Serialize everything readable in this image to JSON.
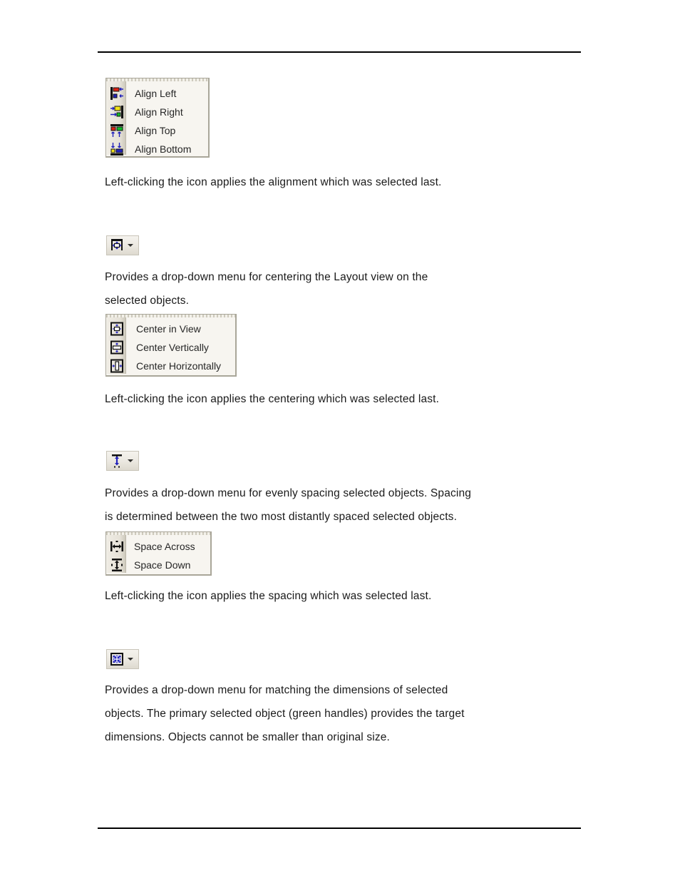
{
  "document": {
    "header_rule": true,
    "footer_rule": true
  },
  "align": {
    "menu_name": "align-dropdown-menu",
    "items": [
      {
        "label": "Align Left",
        "icon": "align-left-icon"
      },
      {
        "label": "Align Right",
        "icon": "align-right-icon"
      },
      {
        "label": "Align Top",
        "icon": "align-top-icon"
      },
      {
        "label": "Align Bottom",
        "icon": "align-bottom-icon"
      }
    ],
    "caption": "Left-clicking the icon applies the alignment which was selected last."
  },
  "center": {
    "button_icon": "center-in-view-toolbar-icon",
    "description": "Provides a drop-down menu for centering the Layout view on the\nselected objects.",
    "items": [
      {
        "label": "Center in View",
        "icon": "center-in-view-icon"
      },
      {
        "label": "Center Vertically",
        "icon": "center-vertically-icon"
      },
      {
        "label": "Center Horizontally",
        "icon": "center-horizontally-icon"
      }
    ],
    "caption": "Left-clicking the icon applies the centering which was selected last."
  },
  "space": {
    "button_icon": "space-down-toolbar-icon",
    "description": "Provides a drop-down menu for evenly spacing selected objects. Spacing\nis determined between the two most distantly spaced selected objects.",
    "items": [
      {
        "label": "Space Across",
        "icon": "space-across-icon"
      },
      {
        "label": "Space Down",
        "icon": "space-down-icon"
      }
    ],
    "caption": "Left-clicking the icon applies the spacing which was selected last."
  },
  "match": {
    "button_icon": "match-dimensions-toolbar-icon",
    "description": "Provides a drop-down menu for matching the dimensions of selected\nobjects. The primary selected object (green handles) provides the target\ndimensions. Objects cannot be smaller than original size."
  },
  "colors": {
    "menu_background": "#f7f5f0",
    "menu_border": "#a9a699",
    "menu_gutter": "#e6e2d8",
    "button_face": "#ebe8e0",
    "icon_blue": "#2222bb",
    "icon_red": "#dd2211",
    "icon_yellow": "#f2e21a",
    "icon_green": "#12bb2a",
    "text": "#1a1a1a"
  }
}
